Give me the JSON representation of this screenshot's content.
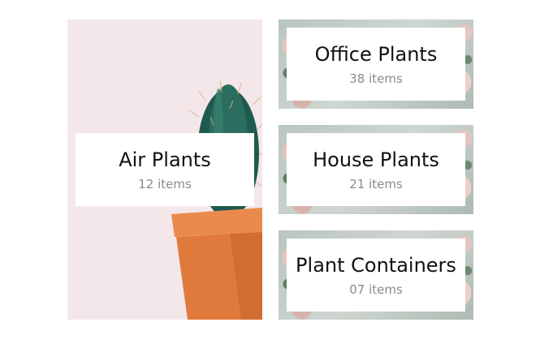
{
  "categories": [
    {
      "title": "Air Plants",
      "count": "12 items"
    },
    {
      "title": "Office Plants",
      "count": "38 items"
    },
    {
      "title": "House Plants",
      "count": "21 items"
    },
    {
      "title": "Plant Containers",
      "count": "07 items"
    }
  ],
  "colors": {
    "air_plants_bg": "#f3e7ea",
    "pot": "#e07a3c",
    "cactus": "#1f5a4e",
    "title_text": "#111111",
    "count_text": "#8a8a8a"
  },
  "icons": {
    "air_plants_image": "cactus-in-orange-pot",
    "small_tiles_image": "roses-and-leaves"
  }
}
